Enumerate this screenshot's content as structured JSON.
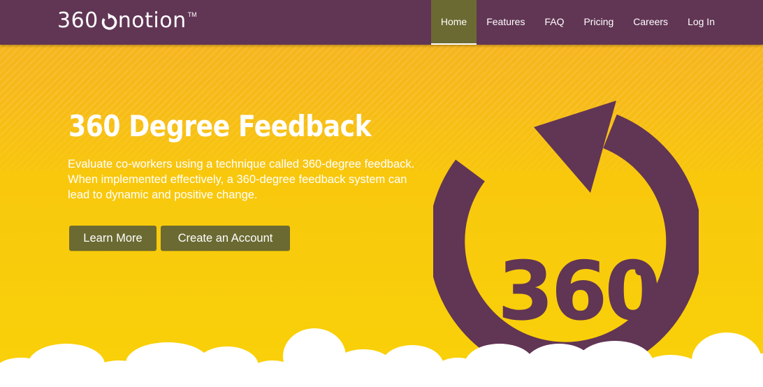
{
  "brand": {
    "name_pre": "360",
    "name_post": "notion",
    "trademark": "TM"
  },
  "nav": {
    "items": [
      {
        "label": "Home",
        "active": true
      },
      {
        "label": "Features",
        "active": false
      },
      {
        "label": "FAQ",
        "active": false
      },
      {
        "label": "Pricing",
        "active": false
      },
      {
        "label": "Careers",
        "active": false
      },
      {
        "label": "Log In",
        "active": false
      }
    ]
  },
  "hero": {
    "title": "360 Degree Feedback",
    "description": "Evaluate co-workers using a technique called 360-degree feedback. When implemented effectively, a 360-degree feedback system can lead to dynamic and positive change.",
    "learn_more_label": "Learn More",
    "create_account_label": "Create an Account",
    "graphic_number": "360",
    "graphic_degree": "o"
  },
  "colors": {
    "header_bg": "#613554",
    "nav_active_bg": "#6b6a32",
    "hero_yellow": "#f8c40e",
    "button_bg": "#6b6a32",
    "graphic_purple": "#613554"
  },
  "icons": [
    "refresh-arrow-icon",
    "circular-arrow-graphic",
    "cloud-border"
  ]
}
